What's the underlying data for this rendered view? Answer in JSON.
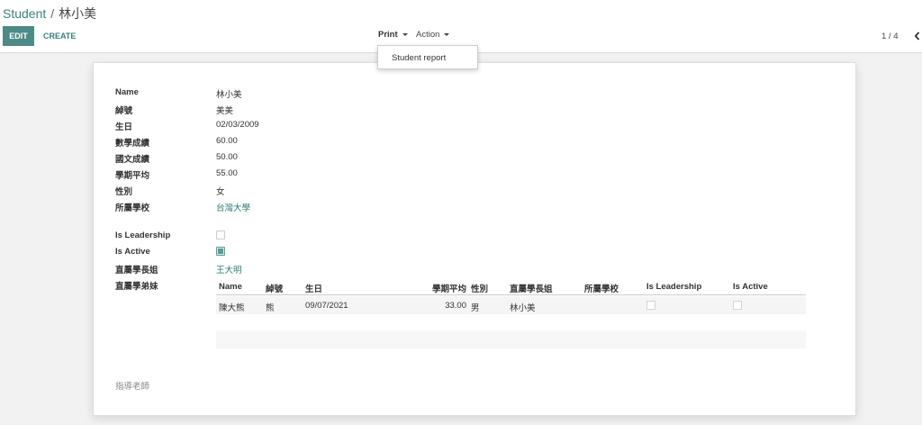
{
  "breadcrumb": {
    "parent": "Student",
    "separator": "/",
    "current": "林小美"
  },
  "toolbar": {
    "edit_label": "EDIT",
    "create_label": "CREATE",
    "print_label": "Print",
    "action_label": "Action"
  },
  "print_menu": {
    "items": [
      "Student report"
    ]
  },
  "pager": {
    "value": "1 / 4"
  },
  "form": {
    "fields": [
      {
        "label": "Name",
        "value": "林小美"
      },
      {
        "label": "綽號",
        "value": "美美"
      },
      {
        "label": "生日",
        "value": "02/03/2009"
      },
      {
        "label": "數學成績",
        "value": "60.00"
      },
      {
        "label": "國文成績",
        "value": "50.00"
      },
      {
        "label": "學期平均",
        "value": "55.00"
      },
      {
        "label": "性別",
        "value": "女"
      },
      {
        "label": "所屬學校",
        "value": "台灣大學"
      }
    ],
    "is_leadership": {
      "label": "Is Leadership",
      "checked": false
    },
    "is_active": {
      "label": "Is Active",
      "checked": true
    },
    "senior": {
      "label": "直屬學長姐",
      "value": "王大明"
    },
    "juniors": {
      "label": "直屬學弟妹",
      "columns": [
        "Name",
        "綽號",
        "生日",
        "學期平均",
        "性別",
        "直屬學長姐",
        "所屬學校",
        "Is Leadership",
        "Is Active"
      ],
      "rows": [
        {
          "name": "陳大熊",
          "nickname": "熊",
          "birthday": "09/07/2021",
          "average": "33.00",
          "gender": "男",
          "senior": "林小美",
          "school": "",
          "is_leadership": false,
          "is_active": false
        }
      ]
    },
    "advisor": {
      "label": "指導老師"
    }
  },
  "colors": {
    "accent": "#4d8a87",
    "link": "#2f7a77"
  }
}
